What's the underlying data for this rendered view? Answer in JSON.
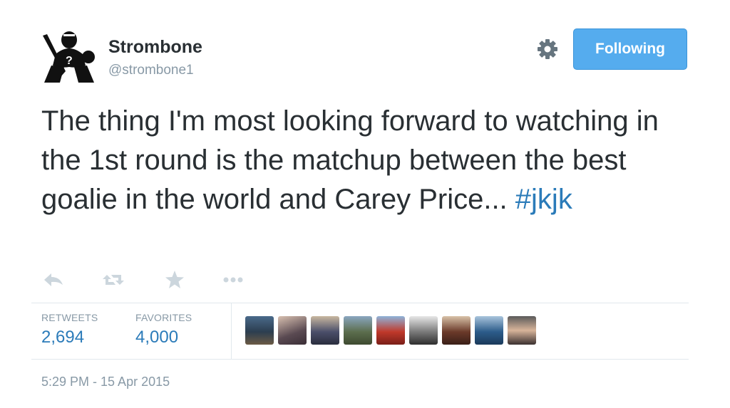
{
  "user": {
    "display_name": "Strombone",
    "handle": "@strombone1",
    "avatar_icon": "goalie-silhouette-icon"
  },
  "follow_button": {
    "label": "Following",
    "color": "#55acee"
  },
  "settings_icon": "gear-icon",
  "tweet": {
    "text": "The thing I'm most looking forward to watching in the 1st round is the matchup between the best goalie in the world and Carey Price... ",
    "hashtag": "#jkjk",
    "hashtag_color": "#2b7bb9"
  },
  "actions": [
    {
      "name": "reply-icon"
    },
    {
      "name": "retweet-icon"
    },
    {
      "name": "favorite-star-icon"
    },
    {
      "name": "more-options-icon"
    }
  ],
  "stats": {
    "retweets_label": "RETWEETS",
    "retweets_count": "2,694",
    "favorites_label": "FAVORITES",
    "favorites_count": "4,000"
  },
  "favorited_by_avatars": [
    {
      "name": "favoriter-avatar-1"
    },
    {
      "name": "favoriter-avatar-2"
    },
    {
      "name": "favoriter-avatar-3"
    },
    {
      "name": "favoriter-avatar-4"
    },
    {
      "name": "favoriter-avatar-5"
    },
    {
      "name": "favoriter-avatar-6"
    },
    {
      "name": "favoriter-avatar-7"
    },
    {
      "name": "favoriter-avatar-8"
    },
    {
      "name": "favoriter-avatar-9"
    }
  ],
  "timestamp": "5:29 PM - 15 Apr 2015"
}
